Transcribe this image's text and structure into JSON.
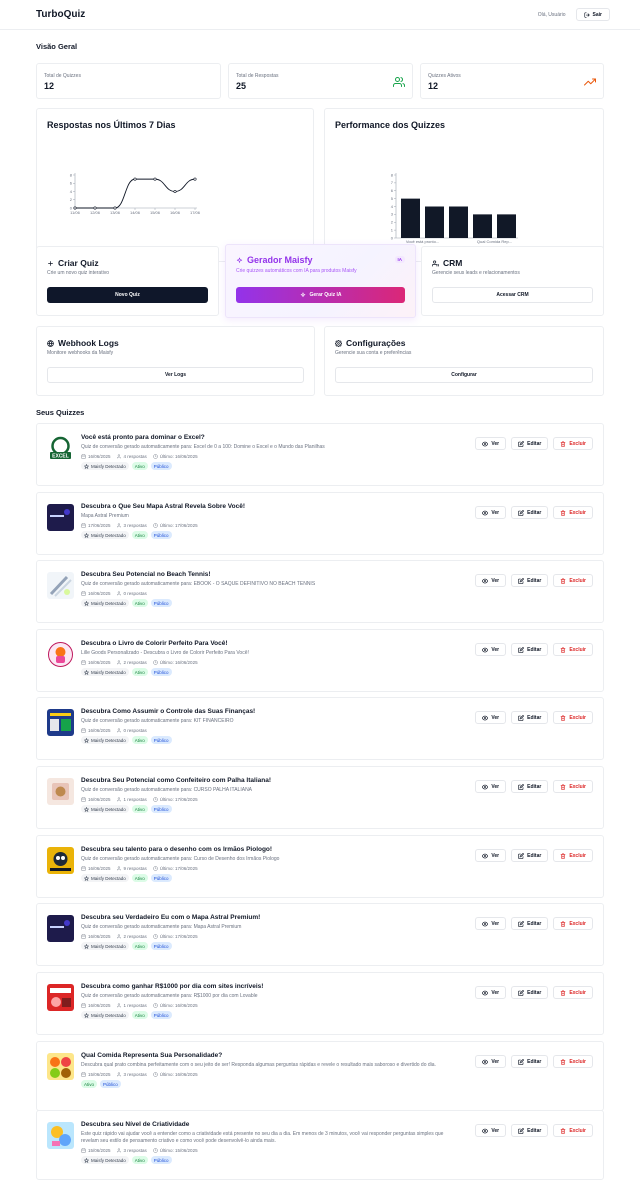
{
  "app": {
    "brand": "TurboQuiz",
    "greeting": "Olá, Usuário",
    "logout_label": "Sair"
  },
  "overview": {
    "title": "Visão Geral",
    "stats": [
      {
        "label": "Total de Quizzes",
        "value": "12",
        "icon": ""
      },
      {
        "label": "Total de Respostas",
        "value": "25",
        "icon": "users-icon",
        "color": "#16a34a"
      },
      {
        "label": "Quizzes Ativos",
        "value": "12",
        "icon": "trending-up-icon",
        "color": "#ea580c"
      }
    ]
  },
  "charts": {
    "responses": {
      "title": "Respostas nos Últimos 7 Dias"
    },
    "performance": {
      "title": "Performance dos Quizzes"
    }
  },
  "chart_data": [
    {
      "type": "line",
      "title": "Respostas nos Últimos 7 Dias",
      "categories": [
        "11/06",
        "12/06",
        "13/06",
        "14/06",
        "15/06",
        "16/06",
        "17/06"
      ],
      "values": [
        0,
        0,
        0,
        7,
        7,
        4,
        7
      ],
      "yticks": [
        0,
        2,
        4,
        6,
        8
      ],
      "ylim": [
        0,
        8
      ]
    },
    {
      "type": "bar",
      "title": "Performance dos Quizzes",
      "tick_labels": [
        "Você está pronto...",
        "Qual Comida Rep..."
      ],
      "values": [
        5,
        4,
        4,
        3,
        3
      ],
      "yticks": [
        0,
        1,
        2,
        3,
        4,
        5,
        6,
        7,
        8
      ],
      "ylim": [
        0,
        8
      ]
    }
  ],
  "actions": {
    "create": {
      "title": "Criar Quiz",
      "desc": "Crie um novo quiz interativo",
      "button": "Novo Quiz"
    },
    "maisfy": {
      "title": "Gerador Maisfy",
      "badge": "IA",
      "desc": "Crie quizzes automáticos com IA para produtos Maisfy",
      "button": "Gerar Quiz IA"
    },
    "crm": {
      "title": "CRM",
      "desc": "Gerencie seus leads e relacionamentos",
      "button": "Acessar CRM"
    },
    "webhooks": {
      "title": "Webhook Logs",
      "desc": "Monitore webhooks da Maisfy",
      "button": "Ver Logs"
    },
    "settings": {
      "title": "Configurações",
      "desc": "Gerencie sua conta e preferências",
      "button": "Configurar"
    }
  },
  "quizzes_section": {
    "title": "Seus Quizzes",
    "view_label": "Ver",
    "edit_label": "Editar",
    "delete_label": "Excluir",
    "tag_maisfy": "Maisfy Detectado",
    "tag_active": "Ativo",
    "tag_public": "Público"
  },
  "quizzes": [
    {
      "title": "Você está pronto para dominar o Excel?",
      "desc": "Quiz de conversão gerado automaticamente para: Excel de 0 a 100: Domine o Excel e o Mundo das Planilhas",
      "date": "16/06/2025",
      "responses": "4 respostas",
      "last": "Último: 16/06/2025",
      "maisfy": true,
      "thumb": "excel"
    },
    {
      "title": "Descubra o Que Seu Mapa Astral Revela Sobre Você!",
      "desc": "Mapa Astral Premium",
      "date": "17/06/2025",
      "responses": "3 respostas",
      "last": "Último: 17/06/2025",
      "maisfy": true,
      "thumb": "astral"
    },
    {
      "title": "Descubra Seu Potencial no Beach Tennis!",
      "desc": "Quiz de conversão gerado automaticamente para: EBOOK - O SAQUE DEFINITIVO NO BEACH TENNIS",
      "date": "16/06/2025",
      "responses": "0 respostas",
      "last": "",
      "maisfy": true,
      "thumb": "tennis"
    },
    {
      "title": "Descubra o Livro de Colorir Perfeito Para Você!",
      "desc": "Lille Goods Personalizado - Descubra o Livro de Colorir Perfeito Para Você!",
      "date": "16/06/2025",
      "responses": "2 respostas",
      "last": "Último: 16/06/2025",
      "maisfy": true,
      "thumb": "coloring"
    },
    {
      "title": "Descubra Como Assumir o Controle das Suas Finanças!",
      "desc": "Quiz de conversão gerado automaticamente para: KIT FINANCEIRO",
      "date": "16/06/2025",
      "responses": "0 respostas",
      "last": "",
      "maisfy": true,
      "thumb": "finance"
    },
    {
      "title": "Descubra Seu Potencial como Confeiteiro com Palha Italiana!",
      "desc": "Quiz de conversão gerado automaticamente para: CURSO PALHA ITALIANA",
      "date": "16/06/2025",
      "responses": "1 respostas",
      "last": "Último: 17/06/2025",
      "maisfy": true,
      "thumb": "candy"
    },
    {
      "title": "Descubra seu talento para o desenho com os Irmãos Piologo!",
      "desc": "Quiz de conversão gerado automaticamente para: Curso de Desenho dos Irmãos Piologo",
      "date": "16/06/2025",
      "responses": "9 respostas",
      "last": "Último: 17/06/2025",
      "maisfy": true,
      "thumb": "drawing"
    },
    {
      "title": "Descubra seu Verdadeiro Eu com o Mapa Astral Premium!",
      "desc": "Quiz de conversão gerado automaticamente para: Mapa Astral Premium",
      "date": "16/06/2025",
      "responses": "2 respostas",
      "last": "Último: 17/06/2025",
      "maisfy": true,
      "thumb": "astral"
    },
    {
      "title": "Descubra como ganhar R$1000 por dia com sites incríveis!",
      "desc": "Quiz de conversão gerado automaticamente para: R$1000 por dia com Lovable",
      "date": "16/06/2025",
      "responses": "1 respostas",
      "last": "Último: 16/06/2025",
      "maisfy": true,
      "thumb": "lovable"
    },
    {
      "title": "Qual Comida Representa Sua Personalidade?",
      "desc": "Descubra qual prato combina perfeitamente com o seu jeito de ser! Responda algumas perguntas rápidas e revele o resultado mais saboroso e divertido do dia.",
      "date": "15/06/2025",
      "responses": "3 respostas",
      "last": "Último: 16/06/2025",
      "maisfy": false,
      "thumb": "food"
    },
    {
      "title": "Descubra seu Nível de Criatividade",
      "desc": "Este quiz rápido vai ajudar você a entender como a criatividade está presente no seu dia a dia. Em menos de 3 minutos, você vai responder perguntas simples que revelam seu estilo de pensamento criativo e como você pode desenvolvê-lo ainda mais.",
      "date": "15/06/2025",
      "responses": "3 respostas",
      "last": "Último: 15/06/2025",
      "maisfy": true,
      "thumb": "creative"
    }
  ]
}
